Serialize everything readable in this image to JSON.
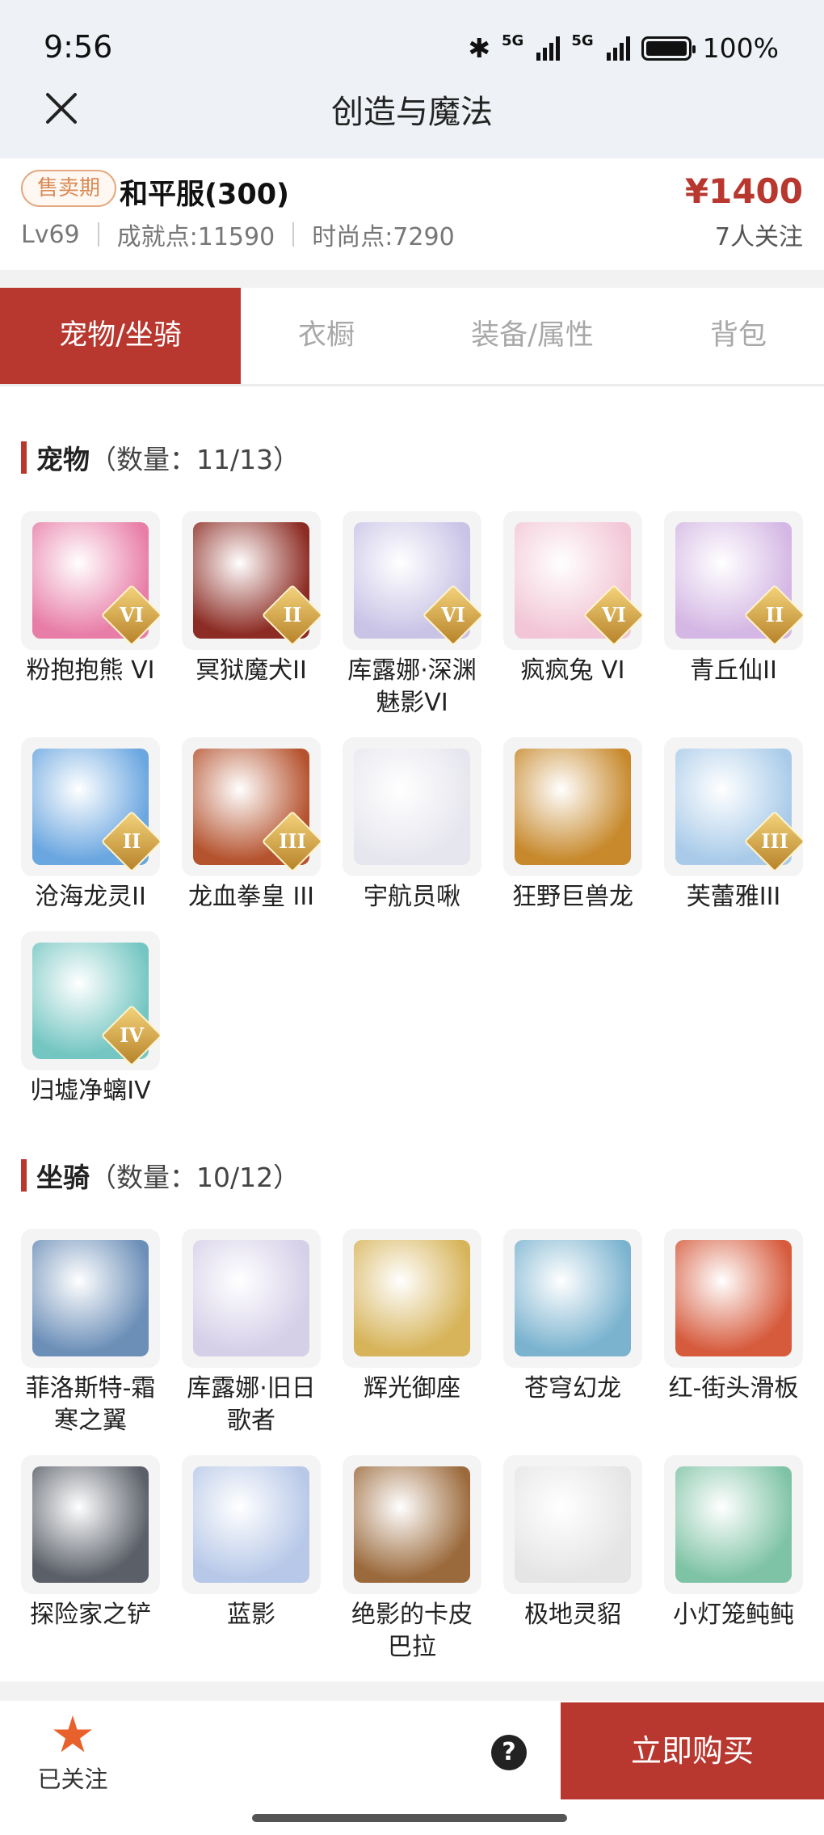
{
  "status": {
    "time": "9:56",
    "battery": "100%",
    "network": "5G",
    "battery_level": 1.0
  },
  "nav": {
    "title": "创造与魔法"
  },
  "listing": {
    "badge": "售卖期",
    "server": "和平服(300)",
    "level": "Lv69",
    "achievement": "成就点:11590",
    "fashion": "时尚点:7290",
    "price": "¥1400",
    "followers": "7人关注"
  },
  "tabs": [
    {
      "label": "宠物/坐骑",
      "active": true
    },
    {
      "label": "衣橱",
      "active": false
    },
    {
      "label": "装备/属性",
      "active": false
    },
    {
      "label": "背包",
      "active": false
    }
  ],
  "pets": {
    "title": "宠物",
    "count": "（数量：11/13）",
    "items": [
      {
        "name": "粉抱抱熊 VI",
        "tier": "VI",
        "color": "#e87ea7"
      },
      {
        "name": "冥狱魔犬II",
        "tier": "II",
        "color": "#8c2c24"
      },
      {
        "name": "库露娜·深渊魅影VI",
        "tier": "VI",
        "color": "#c9c3e6"
      },
      {
        "name": "疯疯兔 VI",
        "tier": "VI",
        "color": "#f2c6d6"
      },
      {
        "name": "青丘仙II",
        "tier": "II",
        "color": "#d4b7e4"
      },
      {
        "name": "沧海龙灵II",
        "tier": "II",
        "color": "#6aa6e0"
      },
      {
        "name": "龙血拳皇 III",
        "tier": "III",
        "color": "#b5532f"
      },
      {
        "name": "宇航员啾",
        "tier": "",
        "color": "#e6e6ee"
      },
      {
        "name": "狂野巨兽龙",
        "tier": "",
        "color": "#c7892c"
      },
      {
        "name": "芙蕾雅III",
        "tier": "III",
        "color": "#a9cbe9"
      },
      {
        "name": "归墟净螭IV",
        "tier": "IV",
        "color": "#74c6c2"
      }
    ]
  },
  "mounts": {
    "title": "坐骑",
    "count": "（数量：10/12）",
    "items": [
      {
        "name": "菲洛斯特-霜寒之翼",
        "color": "#6c8fb8"
      },
      {
        "name": "库露娜·旧日歌者",
        "color": "#d5cfe8"
      },
      {
        "name": "辉光御座",
        "color": "#d7b45a"
      },
      {
        "name": "苍穹幻龙",
        "color": "#7bb3cf"
      },
      {
        "name": "红-街头滑板",
        "color": "#d65a3c"
      },
      {
        "name": "探险家之铲",
        "color": "#5a5f68"
      },
      {
        "name": "蓝影",
        "color": "#b7c8e8"
      },
      {
        "name": "绝影的卡皮巴拉",
        "color": "#9b6a3c"
      },
      {
        "name": "极地灵貂",
        "color": "#e5e5e5"
      },
      {
        "name": "小灯笼鲀鲀",
        "color": "#7fc3a6"
      }
    ]
  },
  "bottom": {
    "follow_label": "已关注",
    "help": "?",
    "buy_label": "立即购买"
  }
}
